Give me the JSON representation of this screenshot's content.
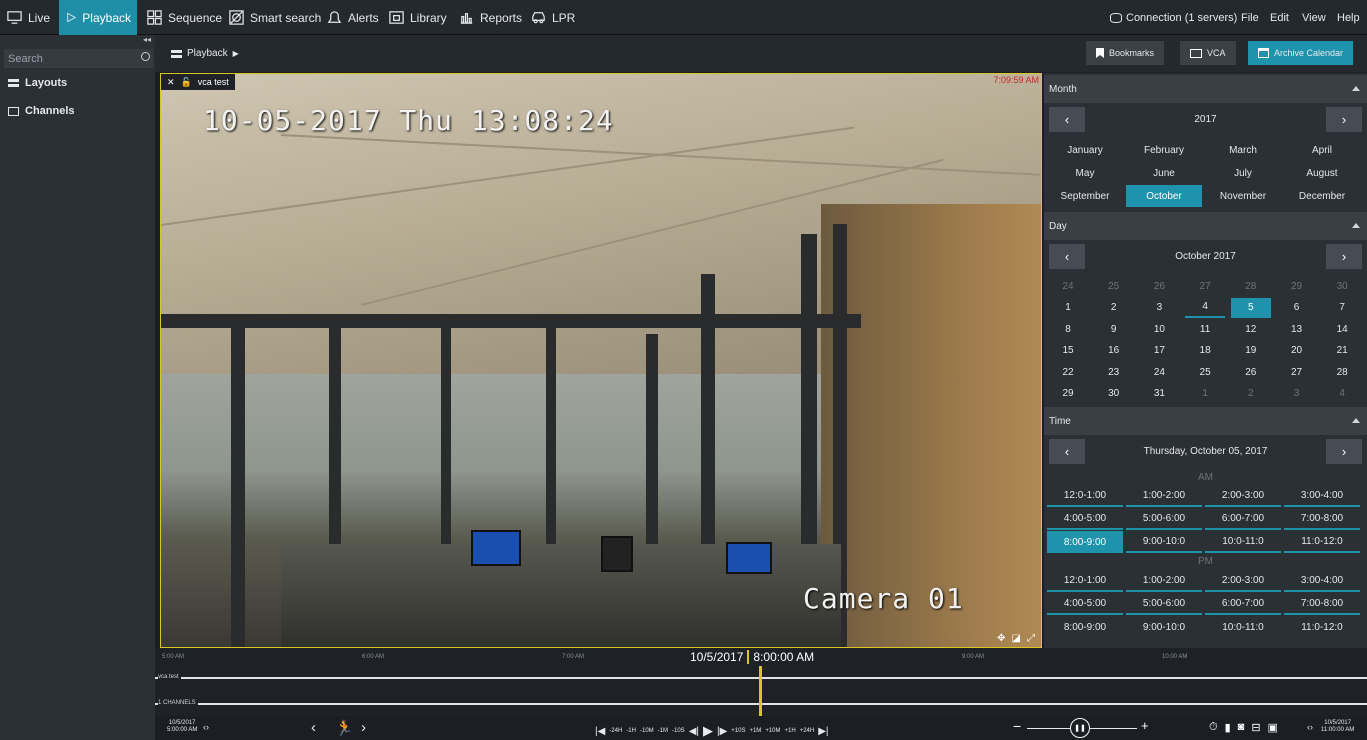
{
  "nav": {
    "tabs": [
      {
        "label": "Live",
        "icon": "monitor-icon"
      },
      {
        "label": "Playback",
        "icon": "play-outline-icon"
      },
      {
        "label": "Sequence",
        "icon": "sequence-grid-icon"
      },
      {
        "label": "Smart search",
        "icon": "smart-search-icon"
      },
      {
        "label": "Alerts",
        "icon": "bell-icon"
      },
      {
        "label": "Library",
        "icon": "library-icon"
      },
      {
        "label": "Reports",
        "icon": "reports-icon"
      },
      {
        "label": "LPR",
        "icon": "car-icon"
      }
    ],
    "connection": "Connection (1 servers)",
    "menu": [
      "File",
      "Edit",
      "View",
      "Help"
    ]
  },
  "sidebar": {
    "search_placeholder": "Search",
    "items": [
      "Layouts",
      "Channels"
    ]
  },
  "toolbar": {
    "breadcrumb": "Playback",
    "bookmarks": "Bookmarks",
    "vca": "VCA",
    "archive_calendar": "Archive Calendar"
  },
  "video": {
    "title": "vca test",
    "corner_time": "7:09:59 AM",
    "osd_datetime": "10-05-2017 Thu 13:08:24",
    "osd_camera": "Camera 01"
  },
  "calendar": {
    "month_header": "Month",
    "year": "2017",
    "months": [
      "January",
      "February",
      "March",
      "April",
      "May",
      "June",
      "July",
      "August",
      "September",
      "October",
      "November",
      "December"
    ],
    "selected_month": "October",
    "day_header": "Day",
    "month_label": "October 2017",
    "days": [
      [
        "24",
        "25",
        "26",
        "27",
        "28",
        "29",
        "30"
      ],
      [
        "1",
        "2",
        "3",
        "4",
        "5",
        "6",
        "7"
      ],
      [
        "8",
        "9",
        "10",
        "11",
        "12",
        "13",
        "14"
      ],
      [
        "15",
        "16",
        "17",
        "18",
        "19",
        "20",
        "21"
      ],
      [
        "22",
        "23",
        "24",
        "25",
        "26",
        "27",
        "28"
      ],
      [
        "29",
        "30",
        "31",
        "1",
        "2",
        "3",
        "4"
      ]
    ],
    "selected_day": "5",
    "time_header": "Time",
    "date_label": "Thursday, October 05, 2017",
    "am_label": "AM",
    "pm_label": "PM",
    "am_slots": [
      "12:0-1:00",
      "1:00-2:00",
      "2:00-3:00",
      "3:00-4:00",
      "4:00-5:00",
      "5:00-6:00",
      "6:00-7:00",
      "7:00-8:00",
      "8:00-9:00",
      "9:00-10:0",
      "10:0-11:0",
      "11:0-12:0"
    ],
    "pm_slots": [
      "12:0-1:00",
      "1:00-2:00",
      "2:00-3:00",
      "3:00-4:00",
      "4:00-5:00",
      "5:00-6:00",
      "6:00-7:00",
      "7:00-8:00",
      "8:00-9:00",
      "9:00-10:0",
      "10:0-11:0",
      "11:0-12:0"
    ],
    "selected_slot": "8:00-9:00"
  },
  "timeline": {
    "ticks": [
      "5:00 AM",
      "6:00 AM",
      "7:00 AM",
      "8:00 AM",
      "9:00 AM",
      "10:00 AM"
    ],
    "cursor_date": "10/5/2017",
    "cursor_time": "8:00:00 AM",
    "tracks": [
      "vca test",
      "1 CHANNELS"
    ],
    "range_start_date": "10/5/2017",
    "range_start_time": "5:00:00 AM",
    "range_end_date": "10/5/2017",
    "range_end_time": "11:00:00 AM",
    "step_back": [
      "-24H",
      "-1H",
      "-10M",
      "-1M",
      "-10S"
    ],
    "step_fwd": [
      "+10S",
      "+1M",
      "+10M",
      "+1H",
      "+24H"
    ]
  },
  "colors": {
    "accent": "#1e93ab",
    "frame": "#d8c623"
  }
}
